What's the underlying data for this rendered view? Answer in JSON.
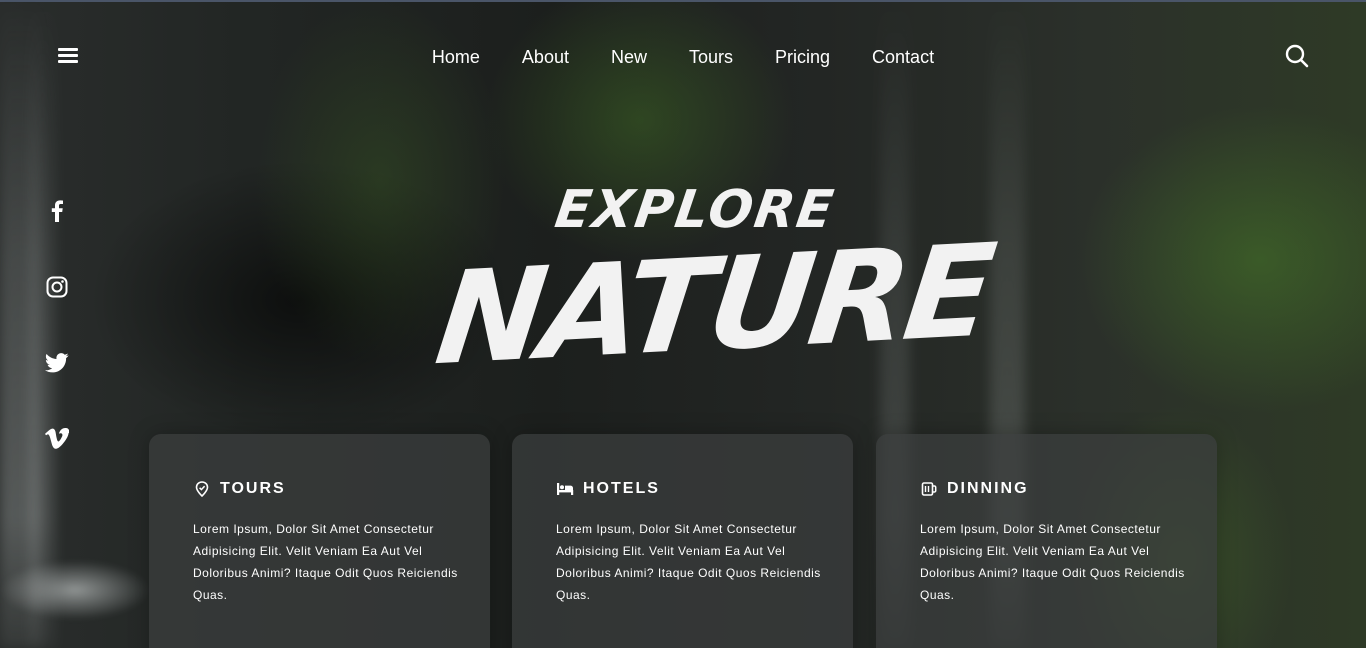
{
  "nav": {
    "menu_icon": "hamburger-icon",
    "search_icon": "search-icon",
    "links": [
      "Home",
      "About",
      "New",
      "Tours",
      "Pricing",
      "Contact"
    ]
  },
  "social": [
    "facebook-icon",
    "instagram-icon",
    "twitter-icon",
    "vimeo-icon"
  ],
  "hero": {
    "title_top": "EXPLORE",
    "title_main": "NATURE"
  },
  "cards": [
    {
      "icon": "map-pin-icon",
      "title": "TOURS",
      "text": "Lorem Ipsum, Dolor Sit Amet Consectetur Adipisicing Elit. Velit Veniam Ea Aut Vel Doloribus Animi? Itaque Odit Quos Reiciendis Quas."
    },
    {
      "icon": "bed-icon",
      "title": "HOTELS",
      "text": "Lorem Ipsum, Dolor Sit Amet Consectetur Adipisicing Elit. Velit Veniam Ea Aut Vel Doloribus Animi? Itaque Odit Quos Reiciendis Quas."
    },
    {
      "icon": "mug-icon",
      "title": "DINNING",
      "text": "Lorem Ipsum, Dolor Sit Amet Consectetur Adipisicing Elit. Velit Veniam Ea Aut Vel Doloribus Animi? Itaque Odit Quos Reiciendis Quas."
    }
  ],
  "colors": {
    "text": "#ffffff",
    "card_bg": "#3c3e3e",
    "title": "#f2f2f2"
  }
}
